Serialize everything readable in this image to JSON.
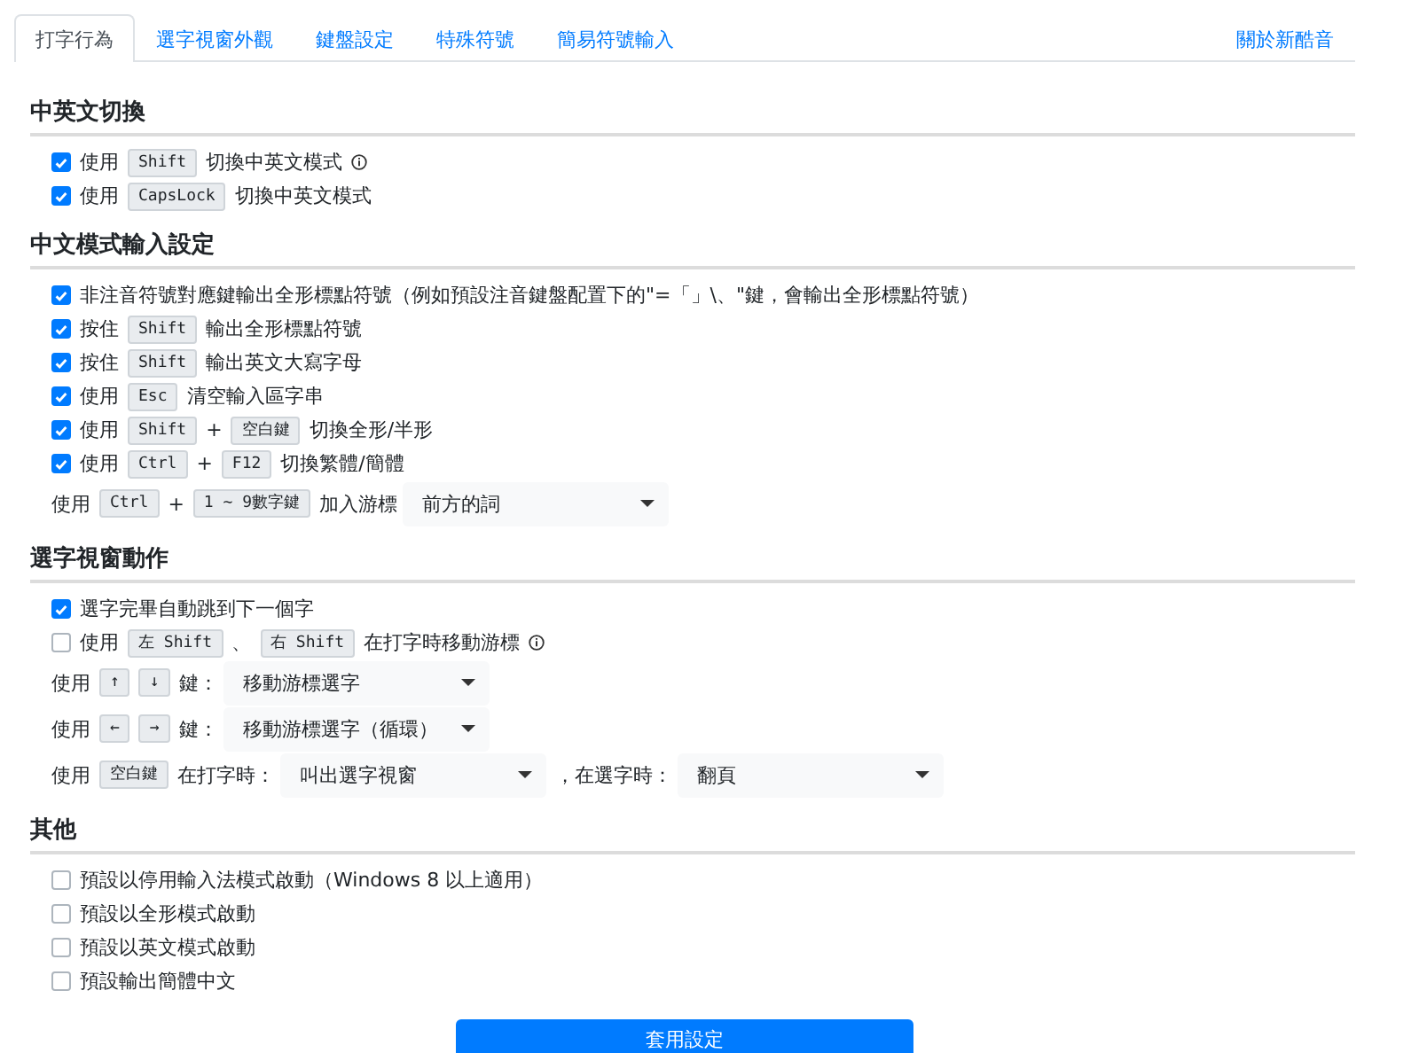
{
  "tabs": [
    {
      "label": "打字行為",
      "selected": true
    },
    {
      "label": "選字視窗外觀",
      "selected": false
    },
    {
      "label": "鍵盤設定",
      "selected": false
    },
    {
      "label": "特殊符號",
      "selected": false
    },
    {
      "label": "簡易符號輸入",
      "selected": false
    }
  ],
  "about_tab": {
    "label": "關於新酷音",
    "selected": false
  },
  "sections": [
    {
      "title": "中英文切換",
      "rows": [
        {
          "kind": "check",
          "checked": true,
          "parts": [
            {
              "kind": "text",
              "text": "使用"
            },
            {
              "kind": "key",
              "text": "Shift"
            },
            {
              "kind": "text",
              "text": "切換中英文模式"
            },
            {
              "kind": "info"
            }
          ]
        },
        {
          "kind": "check",
          "checked": true,
          "parts": [
            {
              "kind": "text",
              "text": "使用"
            },
            {
              "kind": "key",
              "text": "CapsLock"
            },
            {
              "kind": "text",
              "text": "切換中英文模式"
            }
          ]
        }
      ]
    },
    {
      "title": "中文模式輸入設定",
      "rows": [
        {
          "kind": "check",
          "checked": true,
          "parts": [
            {
              "kind": "text",
              "text": "非注音符號對應鍵輸出全形標點符號（例如預設注音鍵盤配置下的\"=「」\\、\"鍵，會輸出全形標點符號）"
            }
          ]
        },
        {
          "kind": "check",
          "checked": true,
          "parts": [
            {
              "kind": "text",
              "text": "按住"
            },
            {
              "kind": "key",
              "text": "Shift"
            },
            {
              "kind": "text",
              "text": "輸出全形標點符號"
            }
          ]
        },
        {
          "kind": "check",
          "checked": true,
          "parts": [
            {
              "kind": "text",
              "text": "按住"
            },
            {
              "kind": "key",
              "text": "Shift"
            },
            {
              "kind": "text",
              "text": "輸出英文大寫字母"
            }
          ]
        },
        {
          "kind": "check",
          "checked": true,
          "parts": [
            {
              "kind": "text",
              "text": "使用"
            },
            {
              "kind": "key",
              "text": "Esc"
            },
            {
              "kind": "text",
              "text": "清空輸入區字串"
            }
          ]
        },
        {
          "kind": "check",
          "checked": true,
          "parts": [
            {
              "kind": "text",
              "text": "使用"
            },
            {
              "kind": "key",
              "text": "Shift"
            },
            {
              "kind": "text",
              "text": "+"
            },
            {
              "kind": "key",
              "text": "空白鍵"
            },
            {
              "kind": "text",
              "text": "切換全形/半形"
            }
          ]
        },
        {
          "kind": "check",
          "checked": true,
          "parts": [
            {
              "kind": "text",
              "text": "使用"
            },
            {
              "kind": "key",
              "text": "Ctrl"
            },
            {
              "kind": "text",
              "text": "+"
            },
            {
              "kind": "key",
              "text": "F12"
            },
            {
              "kind": "text",
              "text": "切換繁體/簡體"
            }
          ]
        },
        {
          "kind": "plain",
          "parts": [
            {
              "kind": "text",
              "text": "使用"
            },
            {
              "kind": "key",
              "text": "Ctrl"
            },
            {
              "kind": "text",
              "text": "+"
            },
            {
              "kind": "key",
              "text": "1 ~ 9數字鍵"
            },
            {
              "kind": "text",
              "text": "加入游標"
            },
            {
              "kind": "select",
              "value": "前方的詞"
            }
          ]
        }
      ]
    },
    {
      "title": "選字視窗動作",
      "rows": [
        {
          "kind": "check",
          "checked": true,
          "parts": [
            {
              "kind": "text",
              "text": "選字完畢自動跳到下一個字"
            }
          ]
        },
        {
          "kind": "check",
          "checked": false,
          "parts": [
            {
              "kind": "text",
              "text": "使用"
            },
            {
              "kind": "key",
              "text": "左 Shift"
            },
            {
              "kind": "text",
              "text": "、"
            },
            {
              "kind": "key",
              "text": "右 Shift"
            },
            {
              "kind": "text",
              "text": "在打字時移動游標"
            },
            {
              "kind": "info"
            }
          ]
        },
        {
          "kind": "plain",
          "parts": [
            {
              "kind": "text",
              "text": "使用"
            },
            {
              "kind": "key",
              "text": "↑"
            },
            {
              "kind": "key",
              "text": "↓"
            },
            {
              "kind": "text",
              "text": "鍵："
            },
            {
              "kind": "select",
              "value": "移動游標選字"
            }
          ]
        },
        {
          "kind": "plain",
          "parts": [
            {
              "kind": "text",
              "text": "使用"
            },
            {
              "kind": "key",
              "text": "←"
            },
            {
              "kind": "key",
              "text": "→"
            },
            {
              "kind": "text",
              "text": "鍵："
            },
            {
              "kind": "select",
              "value": "移動游標選字（循環）"
            }
          ]
        },
        {
          "kind": "plain",
          "parts": [
            {
              "kind": "text",
              "text": "使用"
            },
            {
              "kind": "key",
              "text": "空白鍵"
            },
            {
              "kind": "text",
              "text": "在打字時："
            },
            {
              "kind": "select",
              "value": "叫出選字視窗"
            },
            {
              "kind": "text",
              "text": "，在選字時："
            },
            {
              "kind": "select",
              "value": "翻頁"
            }
          ]
        }
      ]
    },
    {
      "title": "其他",
      "rows": [
        {
          "kind": "check",
          "checked": false,
          "parts": [
            {
              "kind": "text",
              "text": "預設以停用輸入法模式啟動（Windows 8 以上適用）"
            }
          ]
        },
        {
          "kind": "check",
          "checked": false,
          "parts": [
            {
              "kind": "text",
              "text": "預設以全形模式啟動"
            }
          ]
        },
        {
          "kind": "check",
          "checked": false,
          "parts": [
            {
              "kind": "text",
              "text": "預設以英文模式啟動"
            }
          ]
        },
        {
          "kind": "check",
          "checked": false,
          "parts": [
            {
              "kind": "text",
              "text": "預設輸出簡體中文"
            }
          ]
        }
      ]
    }
  ],
  "apply_button": "套用設定"
}
